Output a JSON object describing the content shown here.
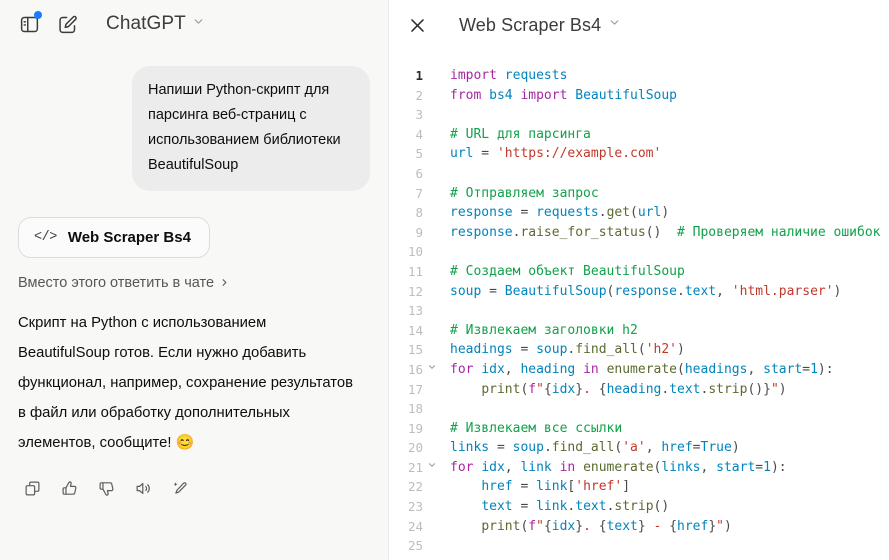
{
  "chat": {
    "topbar": {
      "sidebar_toggle_icon": "sidebar-toggle-icon",
      "new_chat_icon": "compose-pencil-icon",
      "model_name": "ChatGPT",
      "model_chevron": "⌄",
      "notification_dot_color": "#1a7cff"
    },
    "user_message": "Напиши Python-скрипт для парсинга веб-страниц с использованием библиотеки BeautifulSoup",
    "artifact_chip": {
      "code_icon": "</>",
      "title": "Web Scraper Bs4"
    },
    "answer_in_chat_label": "Вместо этого ответить в чате",
    "answer_in_chat_chevron": "›",
    "assistant_message": "Скрипт на Python с использованием BeautifulSoup готов. Если нужно добавить функционал, например, сохранение результатов в файл или обработку дополнительных элементов, сообщите!",
    "assistant_emoji": "😊",
    "actions": [
      {
        "name": "copy-icon",
        "label": "Copy"
      },
      {
        "name": "thumbs-up-icon",
        "label": "Good response"
      },
      {
        "name": "thumbs-down-icon",
        "label": "Bad response"
      },
      {
        "name": "read-aloud-icon",
        "label": "Read aloud"
      },
      {
        "name": "rewrite-icon",
        "label": "Rewrite"
      }
    ]
  },
  "canvas": {
    "close_icon": "close-icon",
    "title": "Web Scraper Bs4",
    "title_chevron": "⌄",
    "code_lines": [
      {
        "n": 1,
        "fold": false,
        "active": true,
        "tokens": [
          {
            "t": "import",
            "c": "kw"
          },
          {
            "t": " ",
            "c": "plain"
          },
          {
            "t": "requests",
            "c": "mod"
          }
        ]
      },
      {
        "n": 2,
        "fold": false,
        "active": false,
        "tokens": [
          {
            "t": "from",
            "c": "kw"
          },
          {
            "t": " ",
            "c": "plain"
          },
          {
            "t": "bs4",
            "c": "mod"
          },
          {
            "t": " ",
            "c": "plain"
          },
          {
            "t": "import",
            "c": "kw"
          },
          {
            "t": " ",
            "c": "plain"
          },
          {
            "t": "BeautifulSoup",
            "c": "cls"
          }
        ]
      },
      {
        "n": 3,
        "fold": false,
        "active": false,
        "tokens": []
      },
      {
        "n": 4,
        "fold": false,
        "active": false,
        "tokens": [
          {
            "t": "# URL для парсинга",
            "c": "cmt"
          }
        ]
      },
      {
        "n": 5,
        "fold": false,
        "active": false,
        "tokens": [
          {
            "t": "url",
            "c": "mod"
          },
          {
            "t": " = ",
            "c": "op"
          },
          {
            "t": "'https://example.com'",
            "c": "str"
          }
        ]
      },
      {
        "n": 6,
        "fold": false,
        "active": false,
        "tokens": []
      },
      {
        "n": 7,
        "fold": false,
        "active": false,
        "tokens": [
          {
            "t": "# Отправляем запрос",
            "c": "cmt"
          }
        ]
      },
      {
        "n": 8,
        "fold": false,
        "active": false,
        "tokens": [
          {
            "t": "response",
            "c": "mod"
          },
          {
            "t": " = ",
            "c": "op"
          },
          {
            "t": "requests",
            "c": "mod"
          },
          {
            "t": ".",
            "c": "op"
          },
          {
            "t": "get",
            "c": "fn"
          },
          {
            "t": "(",
            "c": "op"
          },
          {
            "t": "url",
            "c": "mod"
          },
          {
            "t": ")",
            "c": "op"
          }
        ]
      },
      {
        "n": 9,
        "fold": false,
        "active": false,
        "tokens": [
          {
            "t": "response",
            "c": "mod"
          },
          {
            "t": ".",
            "c": "op"
          },
          {
            "t": "raise_for_status",
            "c": "fn"
          },
          {
            "t": "()  ",
            "c": "op"
          },
          {
            "t": "# Проверяем наличие ошибок",
            "c": "cmt"
          }
        ]
      },
      {
        "n": 10,
        "fold": false,
        "active": false,
        "tokens": []
      },
      {
        "n": 11,
        "fold": false,
        "active": false,
        "tokens": [
          {
            "t": "# Создаем объект BeautifulSoup",
            "c": "cmt"
          }
        ]
      },
      {
        "n": 12,
        "fold": false,
        "active": false,
        "tokens": [
          {
            "t": "soup",
            "c": "mod"
          },
          {
            "t": " = ",
            "c": "op"
          },
          {
            "t": "BeautifulSoup",
            "c": "cls"
          },
          {
            "t": "(",
            "c": "op"
          },
          {
            "t": "response",
            "c": "mod"
          },
          {
            "t": ".",
            "c": "op"
          },
          {
            "t": "text",
            "c": "mod"
          },
          {
            "t": ", ",
            "c": "op"
          },
          {
            "t": "'html.parser'",
            "c": "str"
          },
          {
            "t": ")",
            "c": "op"
          }
        ]
      },
      {
        "n": 13,
        "fold": false,
        "active": false,
        "tokens": []
      },
      {
        "n": 14,
        "fold": false,
        "active": false,
        "tokens": [
          {
            "t": "# Извлекаем заголовки h2",
            "c": "cmt"
          }
        ]
      },
      {
        "n": 15,
        "fold": false,
        "active": false,
        "tokens": [
          {
            "t": "headings",
            "c": "mod"
          },
          {
            "t": " = ",
            "c": "op"
          },
          {
            "t": "soup",
            "c": "mod"
          },
          {
            "t": ".",
            "c": "op"
          },
          {
            "t": "find_all",
            "c": "fn"
          },
          {
            "t": "(",
            "c": "op"
          },
          {
            "t": "'h2'",
            "c": "str"
          },
          {
            "t": ")",
            "c": "op"
          }
        ]
      },
      {
        "n": 16,
        "fold": true,
        "active": false,
        "tokens": [
          {
            "t": "for",
            "c": "kw"
          },
          {
            "t": " ",
            "c": "plain"
          },
          {
            "t": "idx",
            "c": "mod"
          },
          {
            "t": ", ",
            "c": "op"
          },
          {
            "t": "heading",
            "c": "mod"
          },
          {
            "t": " ",
            "c": "plain"
          },
          {
            "t": "in",
            "c": "kw"
          },
          {
            "t": " ",
            "c": "plain"
          },
          {
            "t": "enumerate",
            "c": "fn"
          },
          {
            "t": "(",
            "c": "op"
          },
          {
            "t": "headings",
            "c": "mod"
          },
          {
            "t": ", ",
            "c": "op"
          },
          {
            "t": "start",
            "c": "mod"
          },
          {
            "t": "=",
            "c": "op"
          },
          {
            "t": "1",
            "c": "num"
          },
          {
            "t": "):",
            "c": "op"
          }
        ]
      },
      {
        "n": 17,
        "fold": false,
        "active": false,
        "tokens": [
          {
            "t": "    ",
            "c": "plain"
          },
          {
            "t": "print",
            "c": "fn"
          },
          {
            "t": "(",
            "c": "op"
          },
          {
            "t": "f",
            "c": "kw"
          },
          {
            "t": "\"",
            "c": "str"
          },
          {
            "t": "{",
            "c": "op"
          },
          {
            "t": "idx",
            "c": "mod"
          },
          {
            "t": "}",
            "c": "op"
          },
          {
            "t": ". ",
            "c": "str"
          },
          {
            "t": "{",
            "c": "op"
          },
          {
            "t": "heading",
            "c": "mod"
          },
          {
            "t": ".",
            "c": "op"
          },
          {
            "t": "text",
            "c": "mod"
          },
          {
            "t": ".",
            "c": "op"
          },
          {
            "t": "strip",
            "c": "fn"
          },
          {
            "t": "()}",
            "c": "op"
          },
          {
            "t": "\"",
            "c": "str"
          },
          {
            "t": ")",
            "c": "op"
          }
        ]
      },
      {
        "n": 18,
        "fold": false,
        "active": false,
        "tokens": []
      },
      {
        "n": 19,
        "fold": false,
        "active": false,
        "tokens": [
          {
            "t": "# Извлекаем все ссылки",
            "c": "cmt"
          }
        ]
      },
      {
        "n": 20,
        "fold": false,
        "active": false,
        "tokens": [
          {
            "t": "links",
            "c": "mod"
          },
          {
            "t": " = ",
            "c": "op"
          },
          {
            "t": "soup",
            "c": "mod"
          },
          {
            "t": ".",
            "c": "op"
          },
          {
            "t": "find_all",
            "c": "fn"
          },
          {
            "t": "(",
            "c": "op"
          },
          {
            "t": "'a'",
            "c": "str"
          },
          {
            "t": ", ",
            "c": "op"
          },
          {
            "t": "href",
            "c": "mod"
          },
          {
            "t": "=",
            "c": "op"
          },
          {
            "t": "True",
            "c": "cls"
          },
          {
            "t": ")",
            "c": "op"
          }
        ]
      },
      {
        "n": 21,
        "fold": true,
        "active": false,
        "tokens": [
          {
            "t": "for",
            "c": "kw"
          },
          {
            "t": " ",
            "c": "plain"
          },
          {
            "t": "idx",
            "c": "mod"
          },
          {
            "t": ", ",
            "c": "op"
          },
          {
            "t": "link",
            "c": "mod"
          },
          {
            "t": " ",
            "c": "plain"
          },
          {
            "t": "in",
            "c": "kw"
          },
          {
            "t": " ",
            "c": "plain"
          },
          {
            "t": "enumerate",
            "c": "fn"
          },
          {
            "t": "(",
            "c": "op"
          },
          {
            "t": "links",
            "c": "mod"
          },
          {
            "t": ", ",
            "c": "op"
          },
          {
            "t": "start",
            "c": "mod"
          },
          {
            "t": "=",
            "c": "op"
          },
          {
            "t": "1",
            "c": "num"
          },
          {
            "t": "):",
            "c": "op"
          }
        ]
      },
      {
        "n": 22,
        "fold": false,
        "active": false,
        "tokens": [
          {
            "t": "    ",
            "c": "plain"
          },
          {
            "t": "href",
            "c": "mod"
          },
          {
            "t": " = ",
            "c": "op"
          },
          {
            "t": "link",
            "c": "mod"
          },
          {
            "t": "[",
            "c": "op"
          },
          {
            "t": "'href'",
            "c": "str"
          },
          {
            "t": "]",
            "c": "op"
          }
        ]
      },
      {
        "n": 23,
        "fold": false,
        "active": false,
        "tokens": [
          {
            "t": "    ",
            "c": "plain"
          },
          {
            "t": "text",
            "c": "mod"
          },
          {
            "t": " = ",
            "c": "op"
          },
          {
            "t": "link",
            "c": "mod"
          },
          {
            "t": ".",
            "c": "op"
          },
          {
            "t": "text",
            "c": "mod"
          },
          {
            "t": ".",
            "c": "op"
          },
          {
            "t": "strip",
            "c": "fn"
          },
          {
            "t": "()",
            "c": "op"
          }
        ]
      },
      {
        "n": 24,
        "fold": false,
        "active": false,
        "tokens": [
          {
            "t": "    ",
            "c": "plain"
          },
          {
            "t": "print",
            "c": "fn"
          },
          {
            "t": "(",
            "c": "op"
          },
          {
            "t": "f",
            "c": "kw"
          },
          {
            "t": "\"",
            "c": "str"
          },
          {
            "t": "{",
            "c": "op"
          },
          {
            "t": "idx",
            "c": "mod"
          },
          {
            "t": "}",
            "c": "op"
          },
          {
            "t": ". ",
            "c": "str"
          },
          {
            "t": "{",
            "c": "op"
          },
          {
            "t": "text",
            "c": "mod"
          },
          {
            "t": "}",
            "c": "op"
          },
          {
            "t": " - ",
            "c": "str"
          },
          {
            "t": "{",
            "c": "op"
          },
          {
            "t": "href",
            "c": "mod"
          },
          {
            "t": "}",
            "c": "op"
          },
          {
            "t": "\"",
            "c": "str"
          },
          {
            "t": ")",
            "c": "op"
          }
        ]
      },
      {
        "n": 25,
        "fold": false,
        "active": false,
        "tokens": []
      }
    ]
  }
}
